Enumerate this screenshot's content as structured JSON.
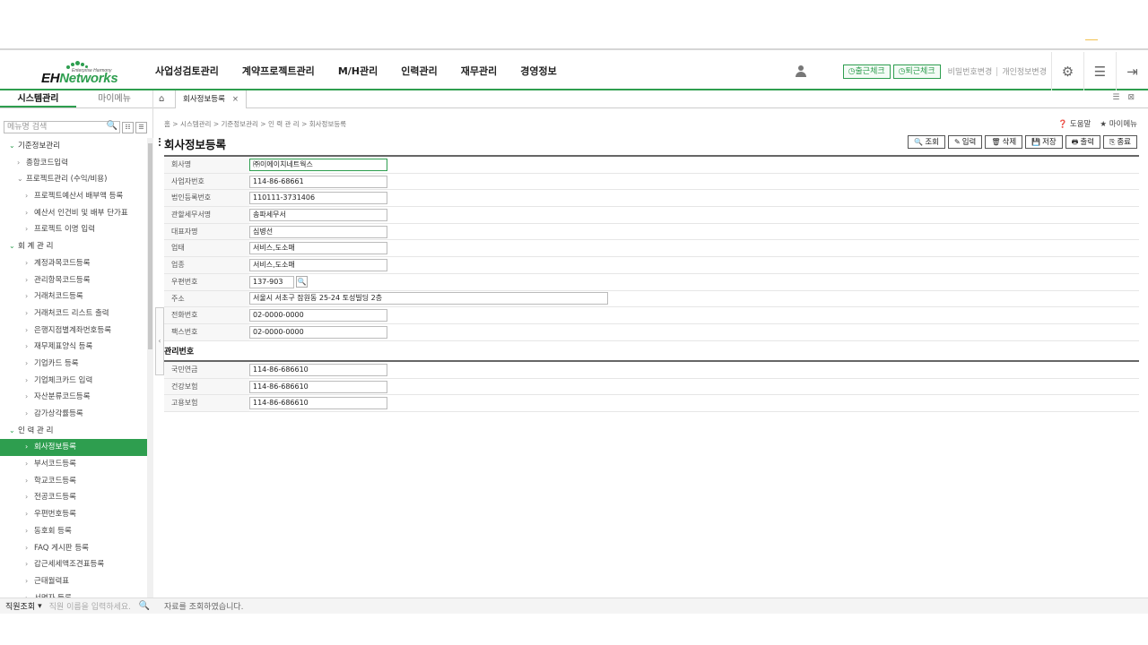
{
  "header": {
    "logo_text_1": "EH",
    "logo_text_2": "Networks",
    "logo_tagline": "Enterprise Harmony",
    "menu": [
      "사업성검토관리",
      "계약프로젝트관리",
      "M/H관리",
      "인력관리",
      "재무관리",
      "경영정보"
    ],
    "check_in": "출근체크",
    "check_out": "퇴근체크",
    "change_password": "비밀번호변경",
    "change_profile": "개인정보변경"
  },
  "sidebar": {
    "tab_system": "시스템관리",
    "tab_mymenu": "마이메뉴",
    "search_placeholder": "메뉴명 검색",
    "items": [
      {
        "label": "기준정보관리",
        "level": 1,
        "expanded": true
      },
      {
        "label": "종합코드입력",
        "level": 2
      },
      {
        "label": "프로젝트관리 (수익/비용)",
        "level": 2,
        "expanded": true
      },
      {
        "label": "프로젝트예산서 배부액 등록",
        "level": 3
      },
      {
        "label": "예산서 인건비 및 배부 단가표",
        "level": 3
      },
      {
        "label": "프로젝트 이명 입력",
        "level": 3
      },
      {
        "label": "회 계 관 리",
        "level": 1,
        "expanded": true
      },
      {
        "label": "계정과목코드등록",
        "level": 3
      },
      {
        "label": "관리항목코드등록",
        "level": 3
      },
      {
        "label": "거래처코드등록",
        "level": 3
      },
      {
        "label": "거래처코드 리스트 출력",
        "level": 3
      },
      {
        "label": "은행지점별계좌번호등록",
        "level": 3
      },
      {
        "label": "재무제표양식 등록",
        "level": 3
      },
      {
        "label": "기업카드 등록",
        "level": 3
      },
      {
        "label": "기업체크카드 입력",
        "level": 3
      },
      {
        "label": "자산분류코드등록",
        "level": 3
      },
      {
        "label": "감가상각률등록",
        "level": 3
      },
      {
        "label": "인 력 관 리",
        "level": 1,
        "expanded": true
      },
      {
        "label": "회사정보등록",
        "level": 3,
        "active": true
      },
      {
        "label": "부서코드등록",
        "level": 3
      },
      {
        "label": "학교코드등록",
        "level": 3
      },
      {
        "label": "전공코드등록",
        "level": 3
      },
      {
        "label": "우편번호등록",
        "level": 3
      },
      {
        "label": "동호회 등록",
        "level": 3
      },
      {
        "label": "FAQ 게시판 등록",
        "level": 3
      },
      {
        "label": "갑근세세액조견표등록",
        "level": 3
      },
      {
        "label": "근태월력표",
        "level": 3
      },
      {
        "label": "서명자 등록",
        "level": 3
      }
    ]
  },
  "bottom": {
    "employee_search_label": "직원조회",
    "employee_search_placeholder": "직원 이름을 입력하세요.",
    "status": "자료를 조회하였습니다."
  },
  "tabbar": {
    "tab_label": "회사정보등록",
    "close": "×"
  },
  "page": {
    "breadcrumb": "홈 > 시스템관리 > 기준정보관리 > 인 력 관 리 > 회사정보등록",
    "help": "도움말",
    "mymenu": "마이메뉴",
    "title": "회사정보등록",
    "actions": [
      {
        "icon": "🔍",
        "label": "조회",
        "name": "search"
      },
      {
        "icon": "✎",
        "label": "입력",
        "name": "insert"
      },
      {
        "icon": "🗑",
        "label": "삭제",
        "name": "delete"
      },
      {
        "icon": "💾",
        "label": "저장",
        "name": "save"
      },
      {
        "icon": "🖶",
        "label": "출력",
        "name": "print"
      },
      {
        "icon": "⎘",
        "label": "종료",
        "name": "close"
      }
    ]
  },
  "form": {
    "company_name": {
      "label": "회사명",
      "value": "㈜이에이치네트웍스"
    },
    "biz_no": {
      "label": "사업자번호",
      "value": "114-86-68661"
    },
    "corp_no": {
      "label": "법인등록번호",
      "value": "110111-3731406"
    },
    "tax_office": {
      "label": "관할세무서명",
      "value": "송파세무서"
    },
    "ceo": {
      "label": "대표자명",
      "value": "심병선"
    },
    "biz_type": {
      "label": "업태",
      "value": "서비스,도소매"
    },
    "biz_item": {
      "label": "업종",
      "value": "서비스,도소매"
    },
    "zip": {
      "label": "우편번호",
      "value": "137-903"
    },
    "address": {
      "label": "주소",
      "value": "서울시 서초구 잠원동 25-24 토성빌딩 2층"
    },
    "phone": {
      "label": "전화번호",
      "value": "02-0000-0000"
    },
    "fax": {
      "label": "팩스번호",
      "value": "02-0000-0000"
    }
  },
  "mgmt": {
    "title": "관리번호",
    "pension": {
      "label": "국민연금",
      "value": "114-86-686610"
    },
    "health": {
      "label": "건강보험",
      "value": "114-86-686610"
    },
    "employment": {
      "label": "고용보험",
      "value": "114-86-686610"
    }
  },
  "colors": {
    "accent": "#2e9e4f"
  }
}
